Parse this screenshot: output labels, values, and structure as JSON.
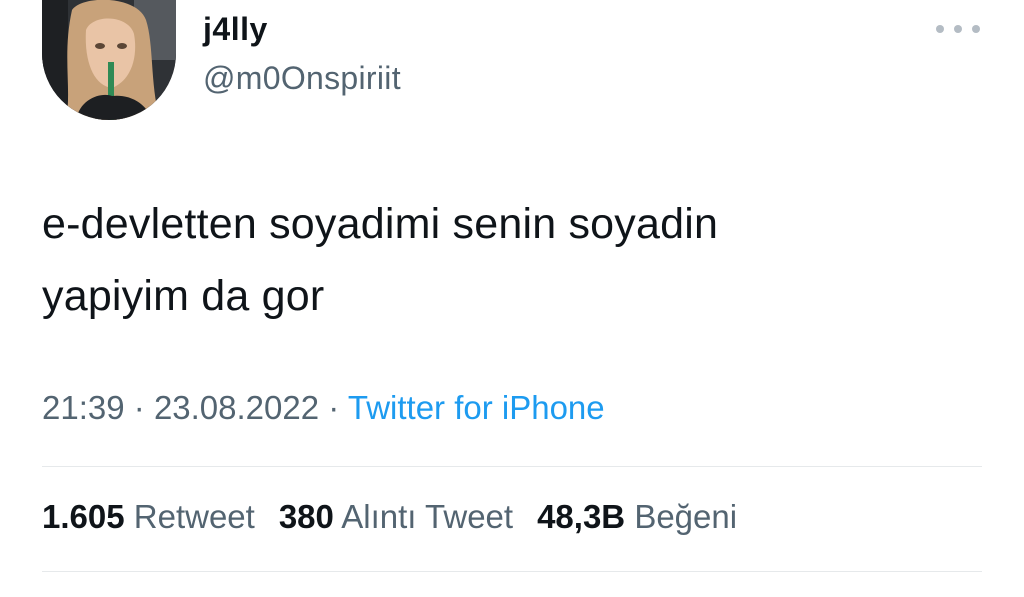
{
  "user": {
    "display_name": "j4lly",
    "handle": "@m0Onspiriit"
  },
  "tweet": {
    "text_line1": "e-devletten soyadimi senin soyadin",
    "text_line2": "yapiyim da gor"
  },
  "meta": {
    "time": "21:39",
    "separator": "·",
    "date": "23.08.2022",
    "source": "Twitter for iPhone"
  },
  "stats": {
    "retweets_count": "1.605",
    "retweets_label": "Retweet",
    "quotes_count": "380",
    "quotes_label": "Alıntı Tweet",
    "likes_count": "48,3B",
    "likes_label": "Beğeni"
  },
  "colors": {
    "text_primary": "#0f1419",
    "text_secondary": "#536471",
    "link": "#1d9bf0",
    "divider": "#e6e9eb"
  },
  "icons": {
    "more": "more-horizontal-icon"
  }
}
